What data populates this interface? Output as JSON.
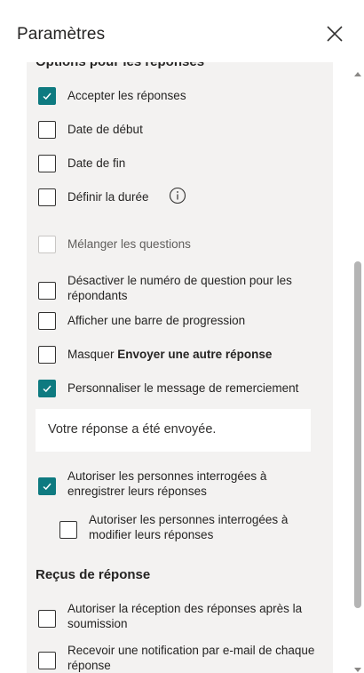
{
  "header": {
    "title": "Paramètres"
  },
  "responses": {
    "section_title": "Options pour les réponses",
    "accept": "Accepter les réponses",
    "start_date": "Date de début",
    "end_date": "Date de fin",
    "duration": "Définir la durée",
    "shuffle": "Mélanger les questions",
    "disable_numbers": "Désactiver le numéro de question pour les répondants",
    "progress_bar": "Afficher une barre de progression",
    "hide_prefix": "Masquer",
    "hide_bold": "Envoyer une autre réponse",
    "custom_thanks": "Personnaliser le message de remerciement",
    "thanks_message": "Votre réponse a été envoyée.",
    "allow_save": "Autoriser les personnes interrogées à enregistrer leurs réponses",
    "allow_edit": "Autoriser les personnes interrogées à modifier leurs réponses"
  },
  "receipts": {
    "section_title": "Reçus de réponse",
    "receipt_after_submit": "Autoriser la réception des réponses après la soumission",
    "email_notification": "Recevoir une notification par e-mail de chaque réponse"
  },
  "checkbox_states": {
    "accept": true,
    "start_date": false,
    "end_date": false,
    "duration": false,
    "shuffle": false,
    "disable_numbers": false,
    "progress_bar": false,
    "hide_another": false,
    "custom_thanks": true,
    "allow_save": true,
    "allow_edit": false,
    "receipt_after_submit": false,
    "email_notification": false
  },
  "colors": {
    "accent": "#0e7a80",
    "panel_background": "#f3f2f1"
  },
  "icons": {
    "close": "close-icon",
    "info": "info-icon",
    "check": "checkmark-icon"
  }
}
